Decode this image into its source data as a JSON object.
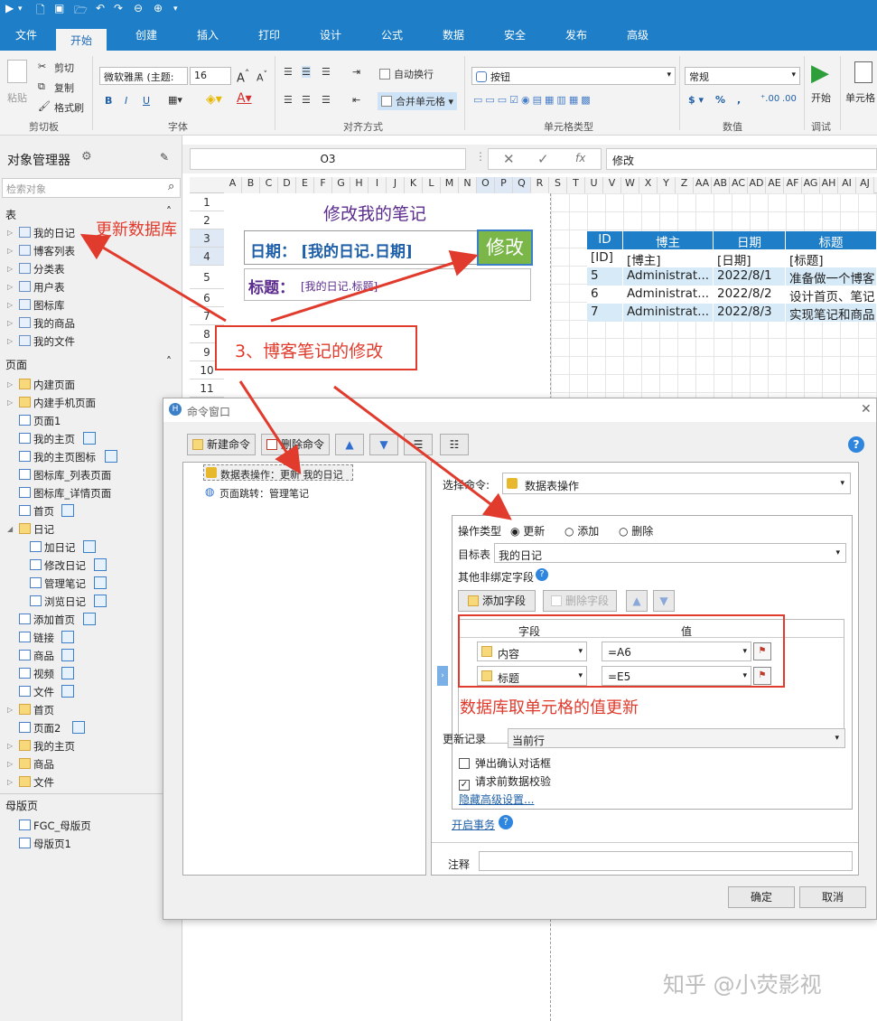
{
  "ribbon": {
    "tabs": [
      "文件",
      "开始",
      "创建",
      "插入",
      "打印",
      "设计",
      "公式",
      "数据",
      "安全",
      "发布",
      "高级"
    ],
    "active_tab": "开始",
    "clipboard": {
      "paste": "粘贴",
      "cut": "剪切",
      "copy": "复制",
      "format_painter": "格式刷",
      "group": "剪切板"
    },
    "font": {
      "name": "微软雅黑 (主题:",
      "size": "16",
      "group": "字体"
    },
    "align": {
      "wrap": "自动换行",
      "merge": "合并单元格",
      "group": "对齐方式"
    },
    "celltype": {
      "value": "按钮",
      "group": "单元格类型"
    },
    "number": {
      "value": "常规",
      "group": "数值"
    },
    "debug": {
      "start": "开始",
      "group": "调试"
    },
    "cell_label": "单元格"
  },
  "left_panel": {
    "title": "对象管理器",
    "search_placeholder": "检索对象",
    "tables_header": "表",
    "tables": [
      "我的日记",
      "博客列表",
      "分类表",
      "用户表",
      "图标库",
      "我的商品",
      "我的文件"
    ],
    "pages_header": "页面",
    "pages": [
      {
        "label": "内建页面",
        "type": "folder",
        "indent": 0
      },
      {
        "label": "内建手机页面",
        "type": "folder",
        "indent": 0
      },
      {
        "label": "页面1",
        "type": "page",
        "indent": 0
      },
      {
        "label": "我的主页",
        "type": "page",
        "indent": 0,
        "badge": true
      },
      {
        "label": "我的主页图标",
        "type": "page",
        "indent": 0,
        "badge": true
      },
      {
        "label": "图标库_列表页面",
        "type": "page",
        "indent": 0
      },
      {
        "label": "图标库_详情页面",
        "type": "page",
        "indent": 0
      },
      {
        "label": "首页",
        "type": "page",
        "indent": 0,
        "badge": true
      },
      {
        "label": "日记",
        "type": "folder",
        "indent": 0,
        "open": true
      },
      {
        "label": "加日记",
        "type": "page",
        "indent": 1,
        "badge": true
      },
      {
        "label": "修改日记",
        "type": "page",
        "indent": 1,
        "badge": true
      },
      {
        "label": "管理笔记",
        "type": "page",
        "indent": 1,
        "badge": true
      },
      {
        "label": "浏览日记",
        "type": "page",
        "indent": 1,
        "badge": true
      },
      {
        "label": "添加首页",
        "type": "page",
        "indent": 0,
        "badge": true
      },
      {
        "label": "链接",
        "type": "page",
        "indent": 0,
        "badge": true
      },
      {
        "label": "商品",
        "type": "page",
        "indent": 0,
        "badge": true
      },
      {
        "label": "视频",
        "type": "page",
        "indent": 0,
        "badge": true
      },
      {
        "label": "文件",
        "type": "page",
        "indent": 0,
        "badge": true
      },
      {
        "label": "首页",
        "type": "folder",
        "indent": 0
      },
      {
        "label": "页面2",
        "type": "page",
        "indent": 0,
        "badge": true
      },
      {
        "label": "我的主页",
        "type": "folder",
        "indent": 0
      },
      {
        "label": "商品",
        "type": "folder",
        "indent": 0
      },
      {
        "label": "文件",
        "type": "folder",
        "indent": 0
      }
    ],
    "master_header": "母版页",
    "masters": [
      "FGC_母版页",
      "母版页1"
    ]
  },
  "formula_bar": {
    "cell_ref": "O3",
    "fx": "fx",
    "value": "修改"
  },
  "sheet": {
    "columns": [
      "A",
      "B",
      "C",
      "D",
      "E",
      "F",
      "G",
      "H",
      "I",
      "J",
      "K",
      "L",
      "M",
      "N",
      "O",
      "P",
      "Q",
      "R",
      "S",
      "T",
      "U",
      "V",
      "W",
      "X",
      "Y",
      "Z",
      "AA",
      "AB",
      "AC",
      "AD",
      "AE",
      "AF",
      "AG",
      "AH",
      "AI",
      "AJ"
    ],
    "rows": [
      "1",
      "2",
      "3",
      "4",
      "5",
      "6",
      "7",
      "8",
      "9",
      "10",
      "11"
    ],
    "heading": "修改我的笔记",
    "date_label": "日期：",
    "date_binding": "[我的日记.日期]",
    "title_label": "标题：",
    "title_binding": "[我的日记.标题]",
    "edit_button": "修改",
    "table_headers": [
      "ID",
      "博主",
      "日期",
      "标题"
    ],
    "table_bind_row": [
      "[ID]",
      "[博主]",
      "[日期]",
      "[标题]"
    ],
    "table_rows": [
      [
        "5",
        "Administrat...",
        "2022/8/1",
        "准备做一个博客"
      ],
      [
        "6",
        "Administrat...",
        "2022/8/2",
        "设计首页、笔记"
      ],
      [
        "7",
        "Administrat...",
        "2022/8/3",
        "实现笔记和商品"
      ]
    ]
  },
  "annotations": {
    "update_db": "更新数据库",
    "step3": "3、博客笔记的修改",
    "cell_value_update": "数据库取单元格的值更新"
  },
  "dialog": {
    "title": "命令窗口",
    "new_cmd": "新建命令",
    "del_cmd": "删除命令",
    "commands": [
      "数据表操作：更新 我的日记",
      "页面跳转：管理笔记"
    ],
    "select_cmd_label": "选择命令:",
    "select_cmd_value": "数据表操作",
    "op_type_label": "操作类型",
    "op_update": "更新",
    "op_add": "添加",
    "op_delete": "删除",
    "target_label": "目标表",
    "target_value": "我的日记",
    "unbound_label": "其他非绑定字段",
    "add_field": "添加字段",
    "del_field": "删除字段",
    "grid_col_field": "字段",
    "grid_col_value": "值",
    "fields": [
      {
        "field": "内容",
        "value": "=A6"
      },
      {
        "field": "标题",
        "value": "=E5"
      }
    ],
    "update_record_label": "更新记录",
    "update_record_value": "当前行",
    "confirm_popup": "弹出确认对话框",
    "validate": "请求前数据校验",
    "hide_advanced": "隐藏高级设置...",
    "transaction": "开启事务",
    "note_label": "注释",
    "ok": "确定",
    "cancel": "取消"
  },
  "watermark": "知乎 @小荧影视"
}
